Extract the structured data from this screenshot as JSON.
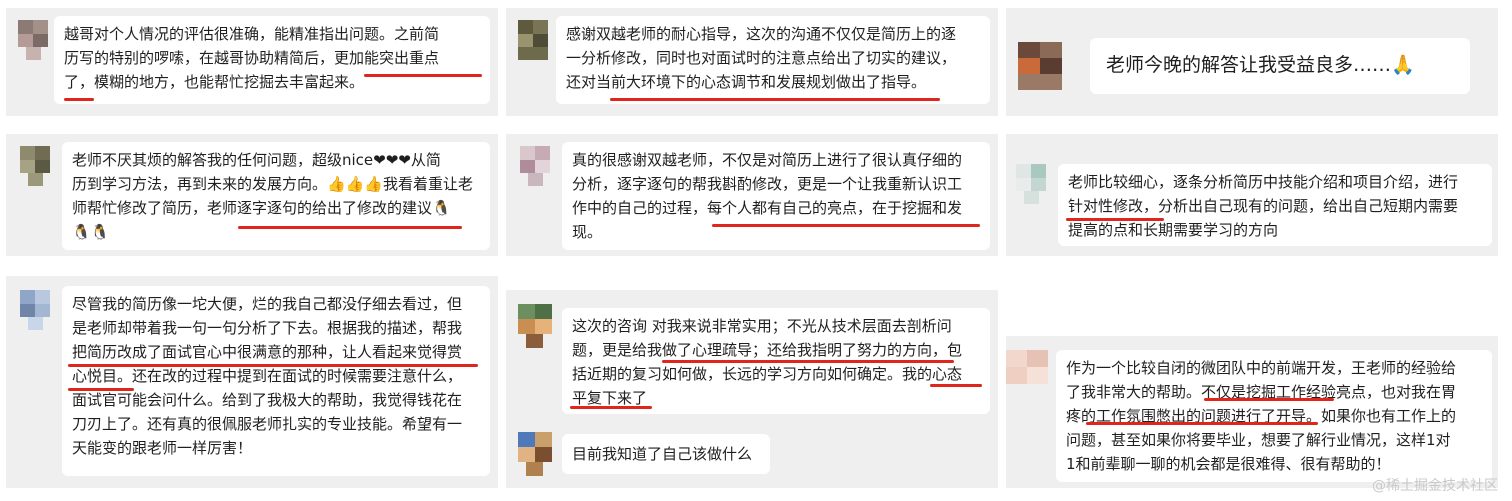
{
  "testimonials": [
    {
      "lines": [
        "越哥对个人情况的评估很准确，能精准指出问题。之前简",
        "历写的特别的啰嗦，在越哥协助精简后，更加能突出重点",
        "了，模糊的地方，也能帮忙挖掘去丰富起来。"
      ]
    },
    {
      "lines": [
        "感谢双越老师的耐心指导，这次的沟通不仅仅是简历上的逐",
        "一分析修改，同时也对面试时的注意点给出了切实的建议，",
        "还对当前大环境下的心态调节和发展规划做出了指导。"
      ]
    },
    {
      "lines": [
        "老师今晚的解答让我受益良多……🙏"
      ]
    },
    {
      "lines": [
        "老师不厌其烦的解答我的任何问题，超级nice❤❤❤从简",
        "历到学习方法，再到未来的发展方向。👍👍👍我看着重让老",
        "师帮忙修改了简历，老师逐字逐句的给出了修改的建议🐧",
        "🐧🐧"
      ]
    },
    {
      "lines": [
        "真的很感谢双越老师，不仅是对简历上进行了很认真仔细的",
        "分析，逐字逐句的帮我斟酌修改，更是一个让我重新认识工",
        "作中的自己的过程，每个人都有自己的亮点，在于挖掘和发",
        "现。"
      ]
    },
    {
      "lines": [
        "老师比较细心，逐条分析简历中技能介绍和项目介绍，进行",
        "针对性修改，分析出自己现有的问题，给出自己短期内需要",
        "提高的点和长期需要学习的方向"
      ]
    },
    {
      "lines": [
        "尽管我的简历像一坨大便，烂的我自己都没仔细去看过，但",
        "是老师却带着我一句一句分析了下去。根据我的描述，帮我",
        "把简历改成了面试官心中很满意的那种，让人看起来觉得赏",
        "心悦目。还在改的过程中提到在面试的时候需要注意什么，",
        "面试官可能会问什么。给到了我极大的帮助，我觉得钱花在",
        "刀刃上了。还有真的很佩服老师扎实的专业技能。希望有一",
        "天能变的跟老师一样厉害！"
      ]
    },
    {
      "lines": [
        "这次的咨询 对我来说非常实用；不光从技术层面去剖析问",
        "题，更是给我做了心理疏导；还给我指明了努力的方向，包",
        "括近期的复习如何做，长远的学习方向如何确定。我的心态",
        "平复下来了"
      ]
    },
    {
      "lines": [
        "目前我知道了自己该做什么"
      ]
    },
    {
      "lines": [
        "作为一个比较自闭的微团队中的前端开发，王老师的经验给",
        "了我非常大的帮助。不仅是挖掘工作经验亮点，也对我在胃",
        "疼的工作氛围憋出的问题进行了开导。如果你也有工作上的",
        "问题，甚至如果你将要毕业，想要了解行业情况，这样1对",
        "1和前辈聊一聊的机会都是很难得、很有帮助的！"
      ]
    }
  ],
  "watermark": "@稀土掘金技术社区",
  "accent_color": "#e0251b"
}
